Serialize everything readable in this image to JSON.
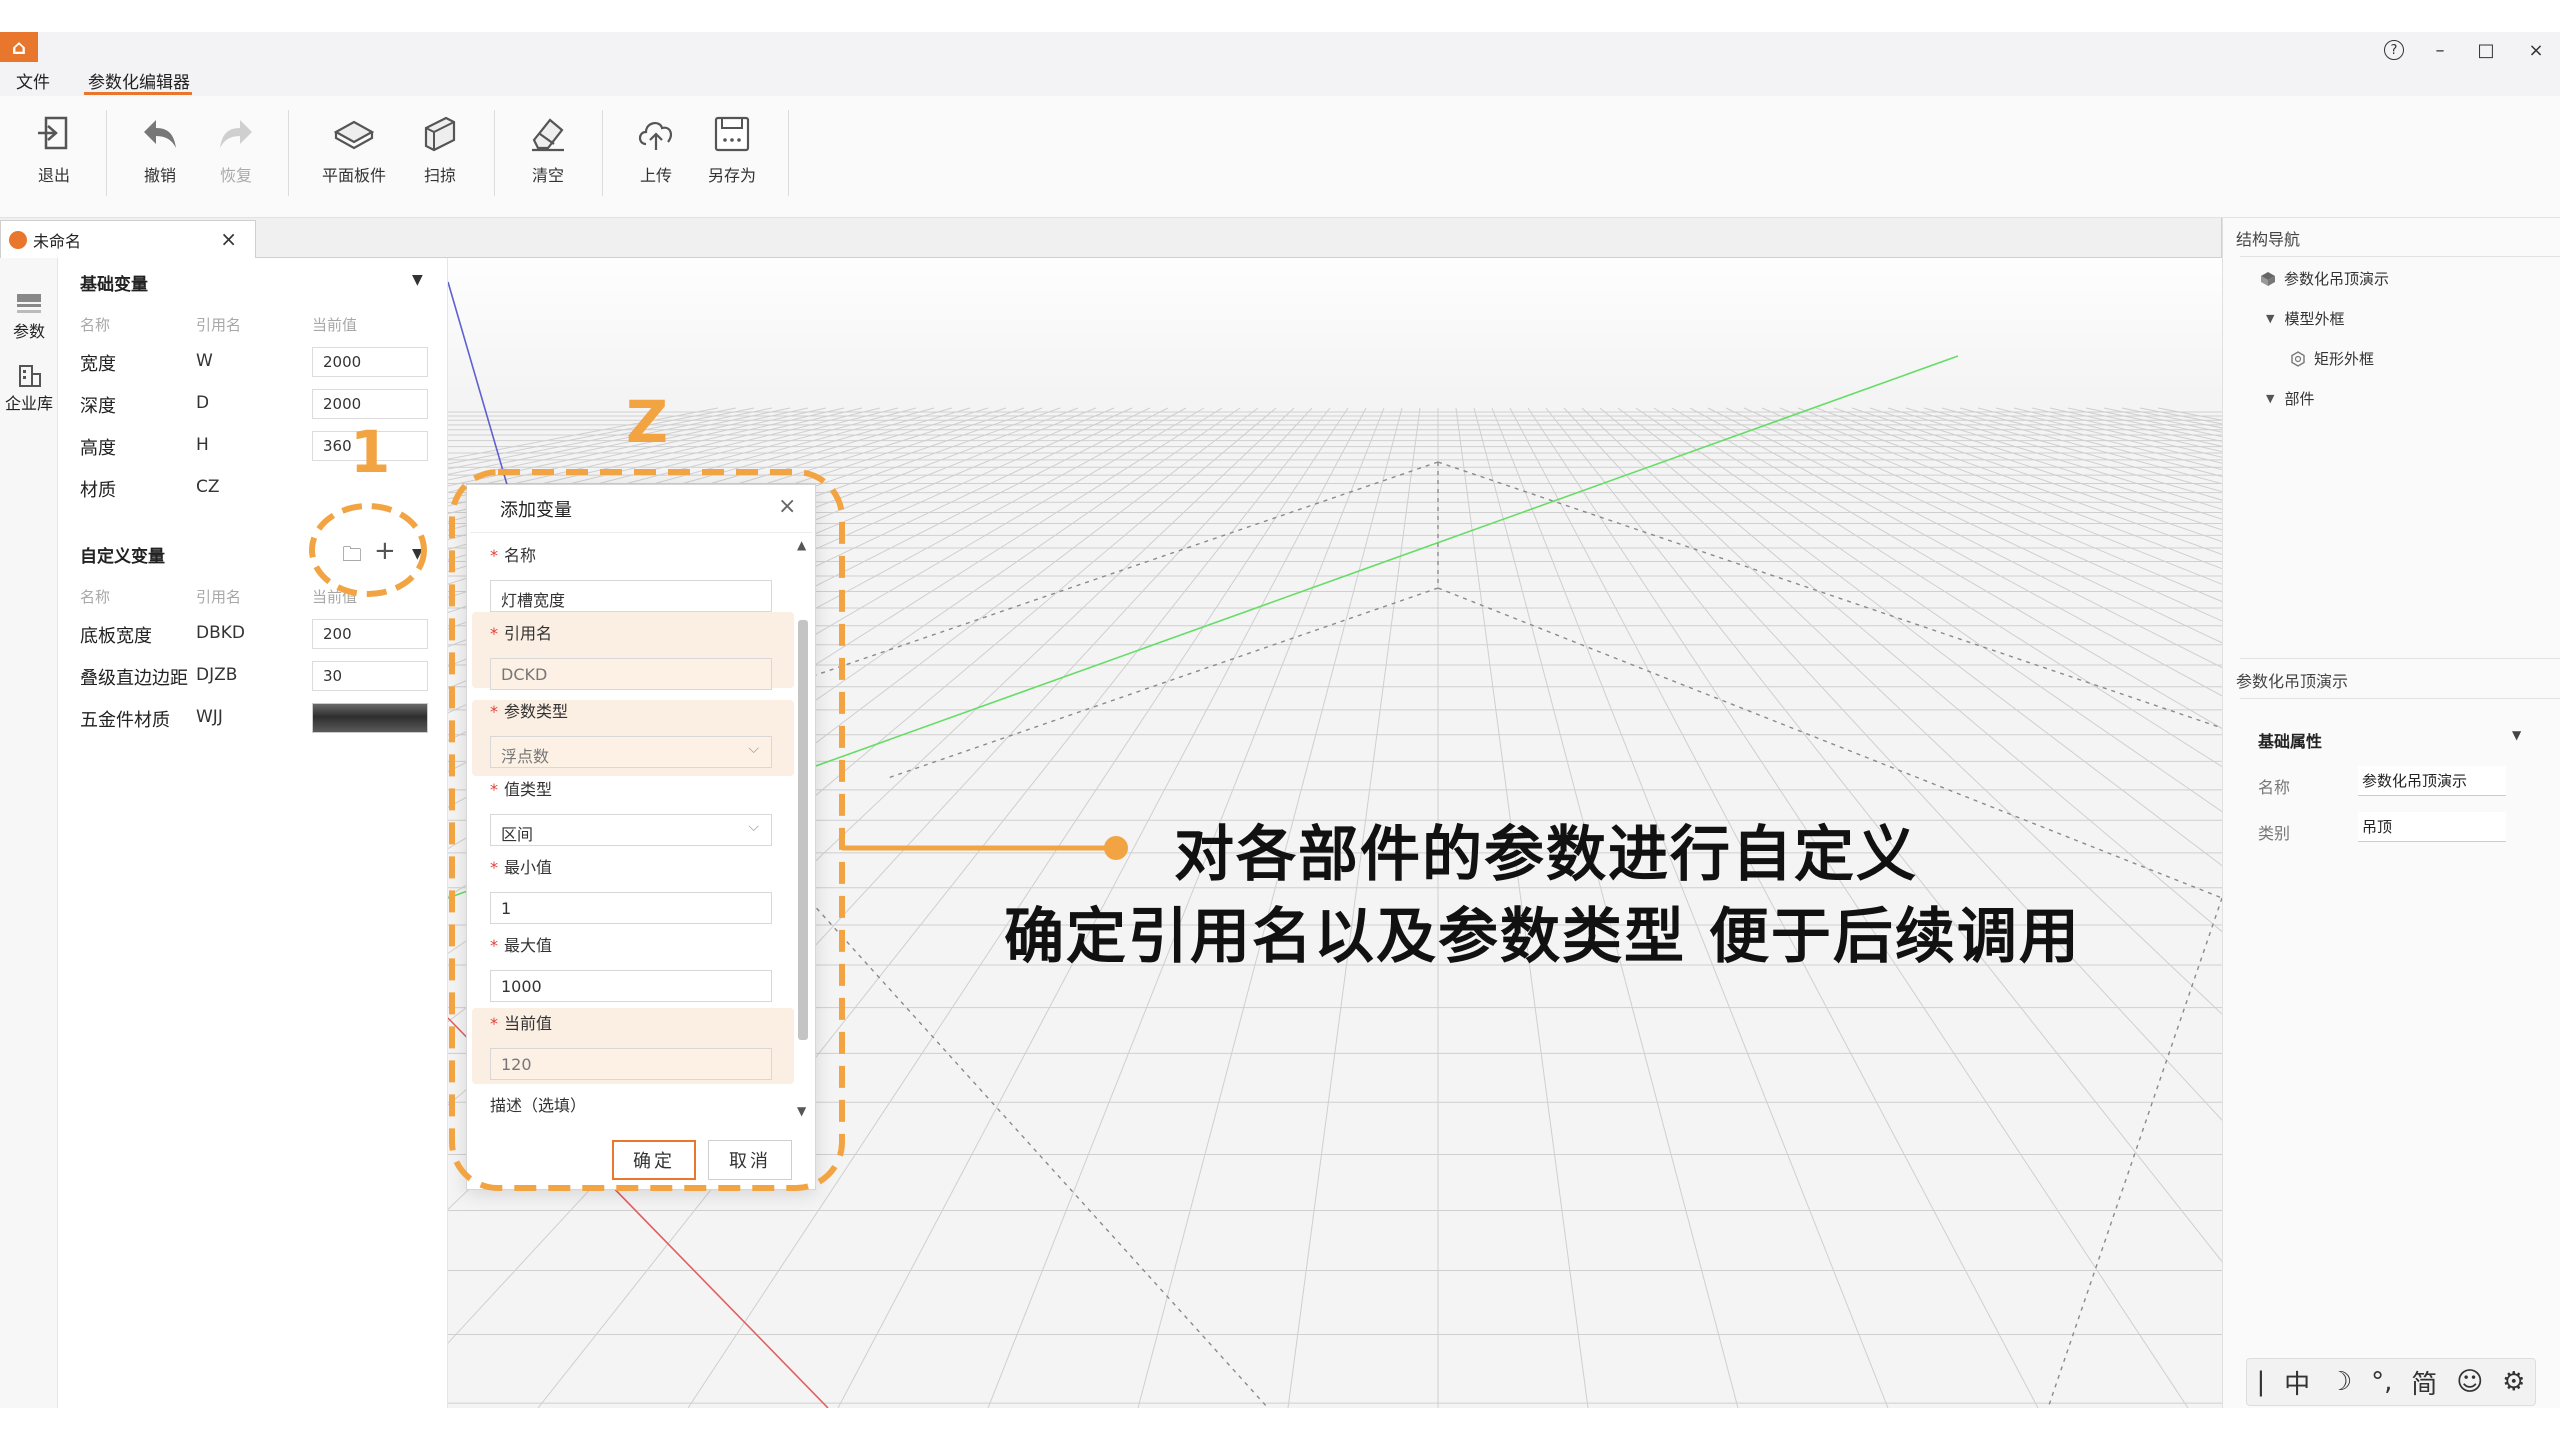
{
  "app": {
    "logo_glyph": "⌂"
  },
  "menu": {
    "file": "文件",
    "editor": "参数化编辑器"
  },
  "window_controls": {
    "help": "?",
    "minimize": "–",
    "maximize": "□",
    "close": "×"
  },
  "toolbar": {
    "exit": "退出",
    "undo": "撤销",
    "redo": "恢复",
    "plane_board": "平面板件",
    "sweep": "扫掠",
    "clear": "清空",
    "upload": "上传",
    "save_as": "另存为"
  },
  "document_tab": {
    "title": "未命名",
    "close": "×"
  },
  "rail": {
    "params": "参数",
    "library": "企业库"
  },
  "basic_vars": {
    "title": "基础变量",
    "headers": {
      "name": "名称",
      "alias": "引用名",
      "value": "当前值"
    },
    "rows": [
      {
        "name": "宽度",
        "alias": "W",
        "value": "2000"
      },
      {
        "name": "深度",
        "alias": "D",
        "value": "2000"
      },
      {
        "name": "高度",
        "alias": "H",
        "value": "360"
      },
      {
        "name": "材质",
        "alias": "CZ",
        "value": ""
      }
    ]
  },
  "custom_vars": {
    "title": "自定义变量",
    "headers": {
      "name": "名称",
      "alias": "引用名",
      "value": "当前值"
    },
    "add_icon": "+",
    "rows": [
      {
        "name": "底板宽度",
        "alias": "DBKD",
        "value": "200"
      },
      {
        "name": "叠级直边边距",
        "alias": "DJZB",
        "value": "30"
      },
      {
        "name": "五金件材质",
        "alias": "WJJ",
        "value": ""
      }
    ]
  },
  "dialog": {
    "title": "添加变量",
    "close": "×",
    "required_mark": "*",
    "fields": {
      "name_label": "名称",
      "name_value": "灯槽宽度",
      "alias_label": "引用名",
      "alias_value": "DCKD",
      "param_type_label": "参数类型",
      "param_type_value": "浮点数",
      "value_type_label": "值类型",
      "value_type_value": "区间",
      "min_label": "最小值",
      "min_value": "1",
      "max_label": "最大值",
      "max_value": "1000",
      "current_label": "当前值",
      "current_value": "120",
      "desc_label": "描述（选填）"
    },
    "ok": "确定",
    "cancel": "取消"
  },
  "right_panel": {
    "nav_title": "结构导航",
    "tree": [
      {
        "label": "参数化吊顶演示",
        "level": 0
      },
      {
        "label": "模型外框",
        "level": 1
      },
      {
        "label": "矩形外框",
        "level": 2
      },
      {
        "label": "部件",
        "level": 1
      }
    ],
    "props_header": "参数化吊顶演示",
    "props_section": "基础属性",
    "props": [
      {
        "label": "名称",
        "value": "参数化吊顶演示"
      },
      {
        "label": "类别",
        "value": "吊顶"
      }
    ]
  },
  "ime": {
    "items": [
      "|",
      "中",
      "☽",
      "°,",
      "简",
      "☺",
      "⚙"
    ]
  },
  "annotations": {
    "step1": "1",
    "step2": "Z",
    "line1": "对各部件的参数进行自定义",
    "line2": "确定引用名以及参数类型  便于后续调用"
  },
  "colors": {
    "accent": "#e8762d",
    "annotation": "#f2a443",
    "highlight": "#fbeee2"
  }
}
